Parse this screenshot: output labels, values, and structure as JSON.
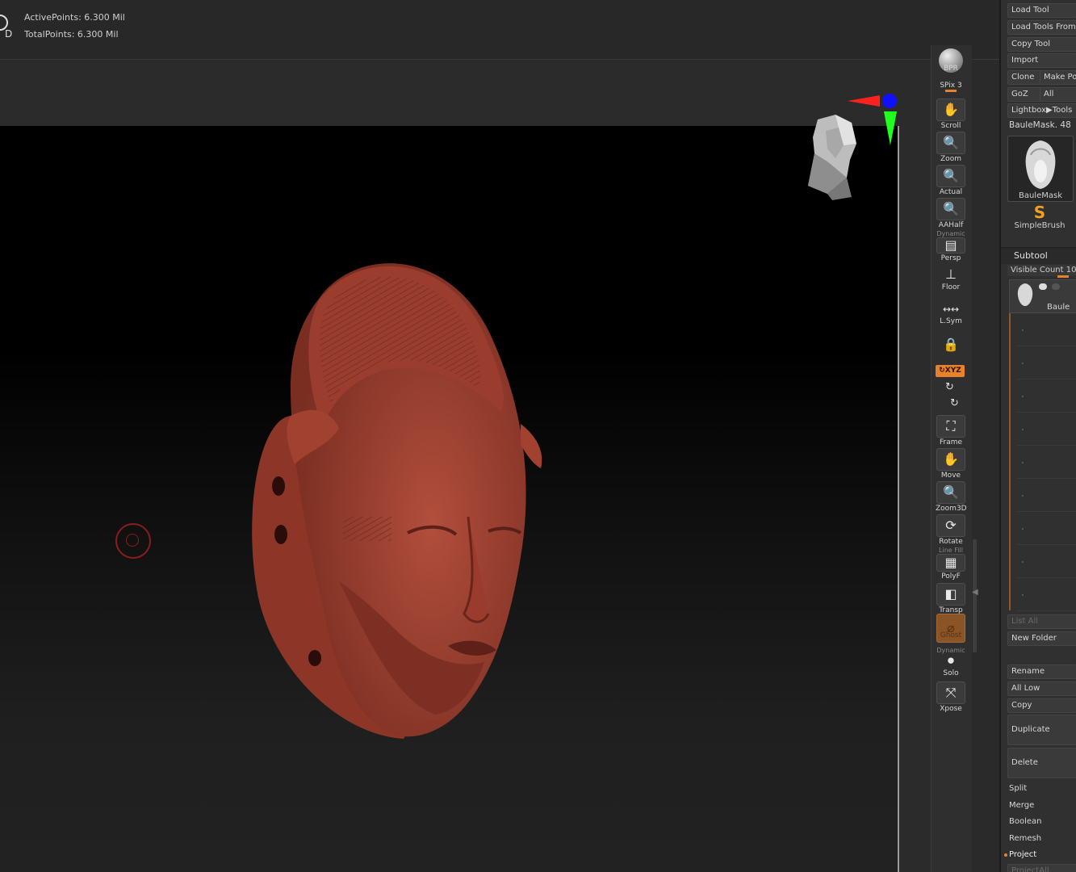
{
  "top_stats": {
    "active_points": "ActivePoints: 6.300 Mil",
    "total_points": "TotalPoints: 6.300 Mil",
    "mode_icon": "D"
  },
  "shelf": {
    "bpr": "BPR",
    "spix": "SPix 3",
    "scroll": "Scroll",
    "zoom": "Zoom",
    "actual": "Actual",
    "aahalf": "AAHalf",
    "persp_over": "Dynamic",
    "persp": "Persp",
    "floor": "Floor",
    "lsym": "L.Sym",
    "xyz": "↻XYZ",
    "frame": "Frame",
    "move": "Move",
    "zoom3d": "Zoom3D",
    "rotate": "Rotate",
    "polyf_over": "Line Fill",
    "polyf": "PolyF",
    "transp": "Transp",
    "ghost": "Ghost",
    "solo_over": "Dynamic",
    "solo": "Solo",
    "xpose": "Xpose"
  },
  "tool_panel": {
    "load_tool": "Load Tool",
    "load_tools_from": "Load Tools From",
    "copy_tool": "Copy Tool",
    "import": "Import",
    "clone": "Clone",
    "make_po": "Make Po",
    "goz": "GoZ",
    "all": "All",
    "lightbox_tools": "Lightbox▶Tools",
    "current_tool": "BauleMask. 48",
    "thumb_label": "BauleMask",
    "brush_label": "SimpleBrush"
  },
  "subtool": {
    "header": "Subtool",
    "visible_count": "Visible Count 10",
    "item_name": "Baule",
    "list_all": "List All",
    "new_folder": "New Folder",
    "rename": "Rename",
    "all_low": "All Low",
    "copy": "Copy",
    "duplicate": "Duplicate",
    "delete": "Delete",
    "split": "Split",
    "merge": "Merge",
    "boolean": "Boolean",
    "remesh": "Remesh",
    "project": "Project",
    "project_all": "ProjectAll"
  },
  "colors": {
    "accent": "#e8822a",
    "mask": "#8f3a2c",
    "gizmo_x": "#ff2020",
    "gizmo_y": "#20ff20",
    "gizmo_z": "#1010ff"
  }
}
